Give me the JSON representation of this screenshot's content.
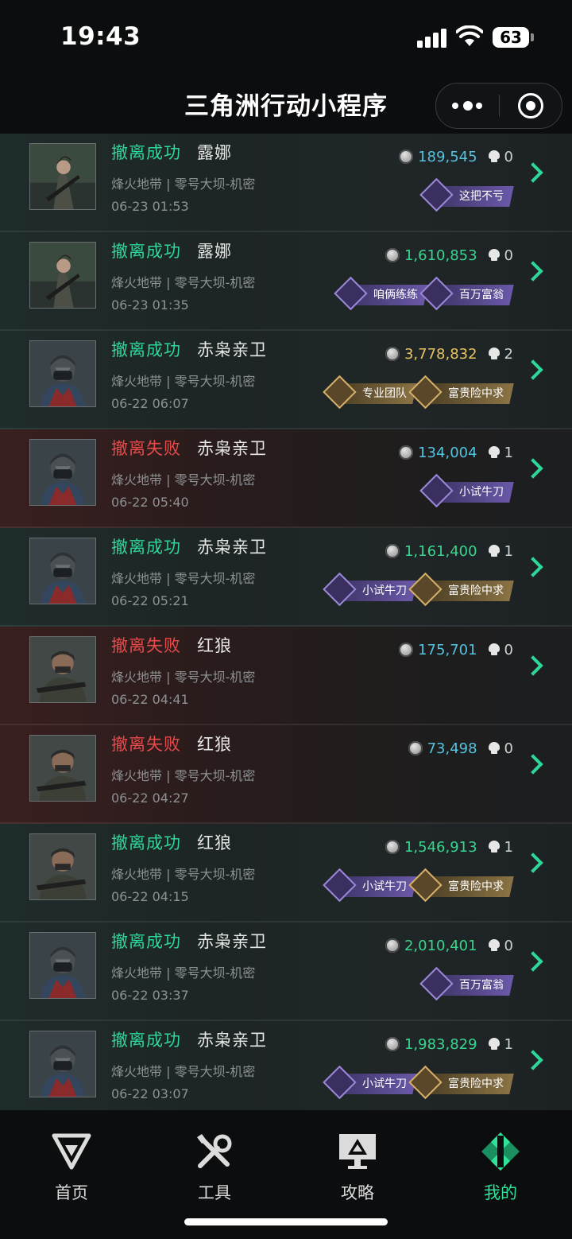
{
  "status_bar": {
    "time": "19:43",
    "battery": "63"
  },
  "nav": {
    "title": "三角洲行动小程序"
  },
  "records": [
    {
      "result": "撤离成功",
      "ok": true,
      "operator": "露娜",
      "mode": "烽火地带 | 零号大坝-机密",
      "datetime": "06-23 01:53",
      "value": "189,545",
      "value_color": "cyan",
      "kills": "0",
      "tags": [
        {
          "label": "这把不亏",
          "style": "purple"
        }
      ]
    },
    {
      "result": "撤离成功",
      "ok": true,
      "operator": "露娜",
      "mode": "烽火地带 | 零号大坝-机密",
      "datetime": "06-23 01:35",
      "value": "1,610,853",
      "value_color": "green",
      "kills": "0",
      "tags": [
        {
          "label": "咱俩练练",
          "style": "purple"
        },
        {
          "label": "百万富翁",
          "style": "purple"
        }
      ]
    },
    {
      "result": "撤离成功",
      "ok": true,
      "operator": "赤枭亲卫",
      "mode": "烽火地带 | 零号大坝-机密",
      "datetime": "06-22 06:07",
      "value": "3,778,832",
      "value_color": "gold",
      "kills": "2",
      "tags": [
        {
          "label": "专业团队",
          "style": "gold"
        },
        {
          "label": "富贵险中求",
          "style": "gold"
        }
      ]
    },
    {
      "result": "撤离失败",
      "ok": false,
      "operator": "赤枭亲卫",
      "mode": "烽火地带 | 零号大坝-机密",
      "datetime": "06-22 05:40",
      "value": "134,004",
      "value_color": "cyan",
      "kills": "1",
      "tags": [
        {
          "label": "小试牛刀",
          "style": "purple"
        }
      ]
    },
    {
      "result": "撤离成功",
      "ok": true,
      "operator": "赤枭亲卫",
      "mode": "烽火地带 | 零号大坝-机密",
      "datetime": "06-22 05:21",
      "value": "1,161,400",
      "value_color": "green",
      "kills": "1",
      "tags": [
        {
          "label": "小试牛刀",
          "style": "purple"
        },
        {
          "label": "富贵险中求",
          "style": "gold"
        }
      ]
    },
    {
      "result": "撤离失败",
      "ok": false,
      "operator": "红狼",
      "mode": "烽火地带 | 零号大坝-机密",
      "datetime": "06-22 04:41",
      "value": "175,701",
      "value_color": "cyan",
      "kills": "0",
      "tags": []
    },
    {
      "result": "撤离失败",
      "ok": false,
      "operator": "红狼",
      "mode": "烽火地带 | 零号大坝-机密",
      "datetime": "06-22 04:27",
      "value": "73,498",
      "value_color": "cyan",
      "kills": "0",
      "tags": []
    },
    {
      "result": "撤离成功",
      "ok": true,
      "operator": "红狼",
      "mode": "烽火地带 | 零号大坝-机密",
      "datetime": "06-22 04:15",
      "value": "1,546,913",
      "value_color": "green",
      "kills": "1",
      "tags": [
        {
          "label": "小试牛刀",
          "style": "purple"
        },
        {
          "label": "富贵险中求",
          "style": "gold"
        }
      ]
    },
    {
      "result": "撤离成功",
      "ok": true,
      "operator": "赤枭亲卫",
      "mode": "烽火地带 | 零号大坝-机密",
      "datetime": "06-22 03:37",
      "value": "2,010,401",
      "value_color": "green",
      "kills": "0",
      "tags": [
        {
          "label": "百万富翁",
          "style": "purple"
        }
      ]
    },
    {
      "result": "撤离成功",
      "ok": true,
      "operator": "赤枭亲卫",
      "mode": "烽火地带 | 零号大坝-机密",
      "datetime": "06-22 03:07",
      "value": "1,983,829",
      "value_color": "green",
      "kills": "1",
      "tags": [
        {
          "label": "小试牛刀",
          "style": "purple"
        },
        {
          "label": "富贵险中求",
          "style": "gold"
        }
      ]
    }
  ],
  "tabs": [
    {
      "label": "首页",
      "icon": "delta-logo-icon",
      "active": false
    },
    {
      "label": "工具",
      "icon": "tools-icon",
      "active": false
    },
    {
      "label": "攻略",
      "icon": "monitor-guide-icon",
      "active": false
    },
    {
      "label": "我的",
      "icon": "profile-diamond-icon",
      "active": true
    }
  ],
  "colors": {
    "success": "#2fd69a",
    "fail": "#e84a4a",
    "accent": "#2fe39a"
  }
}
